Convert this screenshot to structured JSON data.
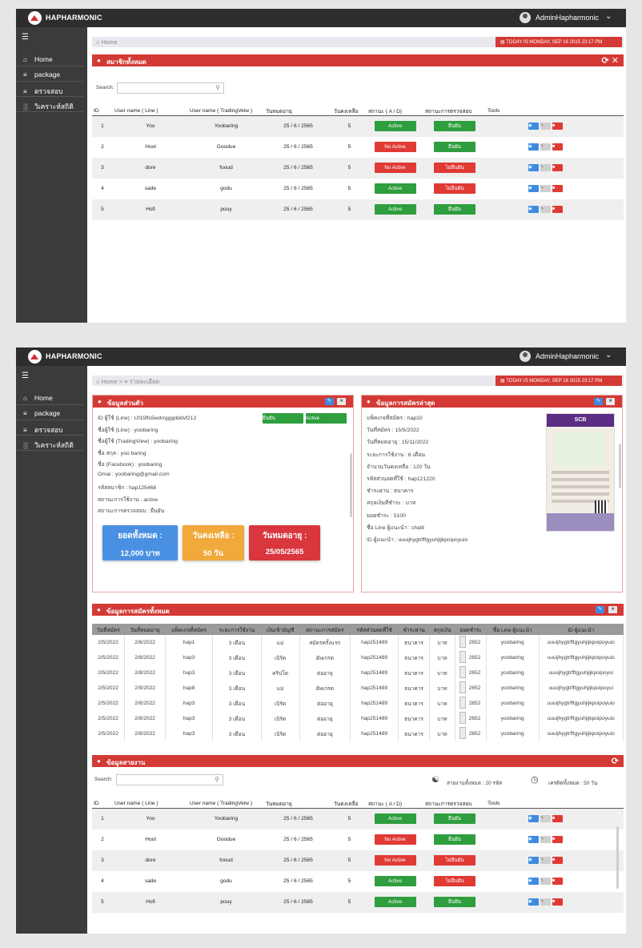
{
  "app": {
    "brand": "HAPHARMONIC",
    "user": "AdminHapharmonic"
  },
  "sidebar": {
    "items": [
      {
        "label": "Home",
        "icon": "home-icon"
      },
      {
        "label": "package",
        "icon": "list-icon"
      },
      {
        "label": "ตรวจสอบ",
        "icon": "list-icon"
      },
      {
        "label": "วิเคราะห์สถิติ",
        "icon": "bar-chart-icon"
      }
    ]
  },
  "date_label": "TODAY IS MONDAY, SEP 16 2015 23:17 PM",
  "screen1": {
    "breadcrumb": "Home",
    "panel_title": "สมาชิกทั้งหมด",
    "search_label": "Search:"
  },
  "members_table": {
    "columns": [
      "ID",
      "User name ( Line )",
      "User name ( TradingVeiw )",
      "วันหมดอายุ",
      "วันคงเหลือ",
      "สถานะ ( A / D)",
      "สถานะการตรวจสอบ",
      "Tools"
    ],
    "rows": [
      {
        "id": "1",
        "line": "Yoo",
        "tv": "Yoobaring",
        "expire": "25 / 6 / 2565",
        "left": "5",
        "status": "Active",
        "status_color": "#2e9e3e",
        "check": "ยืนยัน",
        "check_color": "#2e9e3e"
      },
      {
        "id": "2",
        "line": "Hool",
        "tv": "Goodue",
        "expire": "25 / 6 / 2565",
        "left": "5",
        "status": "No Active",
        "status_color": "#e03a35",
        "check": "ยืนยัน",
        "check_color": "#2e9e3e"
      },
      {
        "id": "3",
        "line": "dore",
        "tv": "fooud",
        "expire": "25 / 6 / 2565",
        "left": "5",
        "status": "No Active",
        "status_color": "#e03a35",
        "check": "ไม่ยืนยัน",
        "check_color": "#e03a35"
      },
      {
        "id": "4",
        "line": "sade",
        "tv": "godu",
        "expire": "25 / 6 / 2565",
        "left": "5",
        "status": "Active",
        "status_color": "#2e9e3e",
        "check": "ไม่ยืนยัน",
        "check_color": "#e03a35"
      },
      {
        "id": "5",
        "line": "Hofi",
        "tv": "pouy",
        "expire": "25 / 6 / 2565",
        "left": "5",
        "status": "Active",
        "status_color": "#2e9e3e",
        "check": "ยืนยัน",
        "check_color": "#2e9e3e"
      }
    ]
  },
  "screen2": {
    "breadcrumb_home": "Home",
    "breadcrumb_sep": ">",
    "breadcrumb_detail": "รายละเอียด",
    "personal": {
      "title": "ข้อมูลส่วนตัว",
      "confirm_label": "ยืนยัน",
      "active_label": "Active",
      "lines": [
        "ID ผู้ใช้ (Line) : Uf15ffs5wdrrgggdddvf212",
        "ชื่อผู้ใช้ (Line) : yoobaring",
        "ชื่อผู้ใช้ (TradingView) : yoobaring",
        "ชื่อ สกุล : yoo baring",
        "ชื่อ (Facebook) : yoobaring",
        "Gmai : yoobaring@gmail.com",
        "รหัสสมาชิก : hap125468",
        "สถานะการใช้งาน : active",
        "สถานะการตรวจสอบ : ยืนยัน"
      ],
      "stats": [
        {
          "label": "ยอดทั้งหมด :",
          "value": "12,000 บาท",
          "color": "#4a90e2"
        },
        {
          "label": "วันคงเหลือ :",
          "value": "50 วัน",
          "color": "#f0a93a"
        },
        {
          "label": "วันหมดอายุ :",
          "value": "25/05/2565",
          "color": "#d9363e"
        }
      ]
    },
    "latest": {
      "title": "ข้อมูลการสมัครล่าสุด",
      "lines": [
        "แพ็คเกจที่สมัคร : hap10",
        "วันที่สมัคร : 15/5/2022",
        "วันที่หมดอายุ : 15/11/2022",
        "ระยะการใช้งาน : 6 เดือน",
        "จำนวนวันคงเหลือ : 120 วัน",
        "รหัสส่วนลดที่ใช้ : hap121220",
        "ชำระผ่าน : ธนาคาร",
        "สกุลเงินที่ชำระ : บาท",
        "ยอดชำระ : 5100",
        "ชื่อ Line ผู้แนะนำ : chalit",
        "ID ผู้แนะนำ : uuuijhygtrfftgyuhjijkpoipoyuio"
      ],
      "receipt_bank": "SCB"
    },
    "registrations": {
      "title": "ข้อมูลการสมัครทั้งหมด",
      "columns": [
        "วันที่สมัคร",
        "วันที่หมดอายุ",
        "แพ็คเกจที่สมัคร",
        "ระยะการใช้งาน",
        "เงินเข้าบัญชี",
        "สถานะการสมัคร",
        "รหัสส่วนลดที่ใช้",
        "ชำระผ่าน",
        "สกุลเงิน",
        "ยอดชำระ",
        "ชื่อ Line ผู้แนะนำ",
        "ID ผู้แนะนำ"
      ],
      "rows": [
        [
          "2/5/2022",
          "2/6/2022",
          "hap1",
          "3 เดือน",
          "แม่",
          "สมัครครั้งแรก",
          "hap251489",
          "ธนาคาร",
          "บาท",
          "2652",
          "yoobaring",
          "uuuijhygtrfftgyuhjijkpoipoyuio"
        ],
        [
          "2/5/2022",
          "2/8/2022",
          "hap3",
          "3 เดือน",
          "เบิร์ด",
          "อัพเกรด",
          "hap251489",
          "ธนาคาร",
          "บาท",
          "2652",
          "yoobaring",
          "uuuijhygtrfftgyuhjijkpoipoyuio"
        ],
        [
          "2/5/2022",
          "2/8/2022",
          "hap3",
          "3 เดือน",
          "คริปโต",
          "ต่ออายุ",
          "hap251489",
          "ธนาคาร",
          "บาท",
          "2652",
          "yoobaring",
          "uuuijhygtrfftgyuhjijkpoipoyui"
        ],
        [
          "2/5/2022",
          "2/9/2022",
          "hap8",
          "3 เดือน",
          "แม่",
          "อัพเกรด",
          "hap251489",
          "ธนาคาร",
          "บาท",
          "2652",
          "yoobaring",
          "uuuijhygtrfftgyuhjijkpoipoyui"
        ],
        [
          "2/5/2022",
          "2/8/2022",
          "hap3",
          "3 เดือน",
          "เบิร์ด",
          "ต่ออายุ",
          "hap251489",
          "ธนาคาร",
          "บาท",
          "2652",
          "yoobaring",
          "uuuijhygtrfftgyuhjijkpoipoyuio"
        ],
        [
          "2/5/2022",
          "2/8/2022",
          "hap3",
          "3 เดือน",
          "เบิร์ด",
          "ต่ออายุ",
          "hap251489",
          "ธนาคาร",
          "บาท",
          "2652",
          "yoobaring",
          "uuuijhygtrfftgyuhjijkpoipoyuio"
        ],
        [
          "2/5/2022",
          "2/8/2022",
          "hap3",
          "3 เดือน",
          "เบิร์ด",
          "ต่ออายุ",
          "hap251489",
          "ธนาคาร",
          "บาท",
          "2652",
          "yoobaring",
          "uuuijhygtrfftgyuhjijkpoipoyuio"
        ]
      ]
    },
    "network": {
      "title": "ข้อมูลสายงาน",
      "search_label": "Search:",
      "summary_members": "สายงานทั้งหมด : 20 รหัส",
      "summary_credit": "เครดิตทั้งหมด : 50 วัน"
    }
  }
}
